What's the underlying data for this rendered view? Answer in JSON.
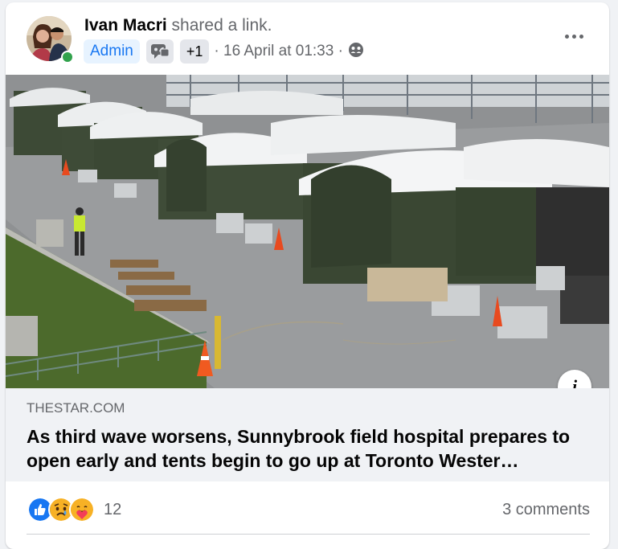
{
  "post": {
    "author_name": "Ivan Macri",
    "action_text": " shared a link.",
    "badge_admin": "Admin",
    "badge_plus": "+1",
    "timestamp": "· 16 April at 01:33 ·"
  },
  "link": {
    "domain": "THESTAR.COM",
    "title": "As third wave worsens, Sunnybrook field hospital prepares to open early and tents begin to go up at Toronto Wester…"
  },
  "reactions": {
    "count": "12",
    "comments": "3 comments",
    "icons": [
      "like-icon",
      "sad-icon",
      "care-icon"
    ]
  },
  "colors": {
    "accent": "#1877f2",
    "online": "#31a24c",
    "muted_text": "#65676b"
  }
}
